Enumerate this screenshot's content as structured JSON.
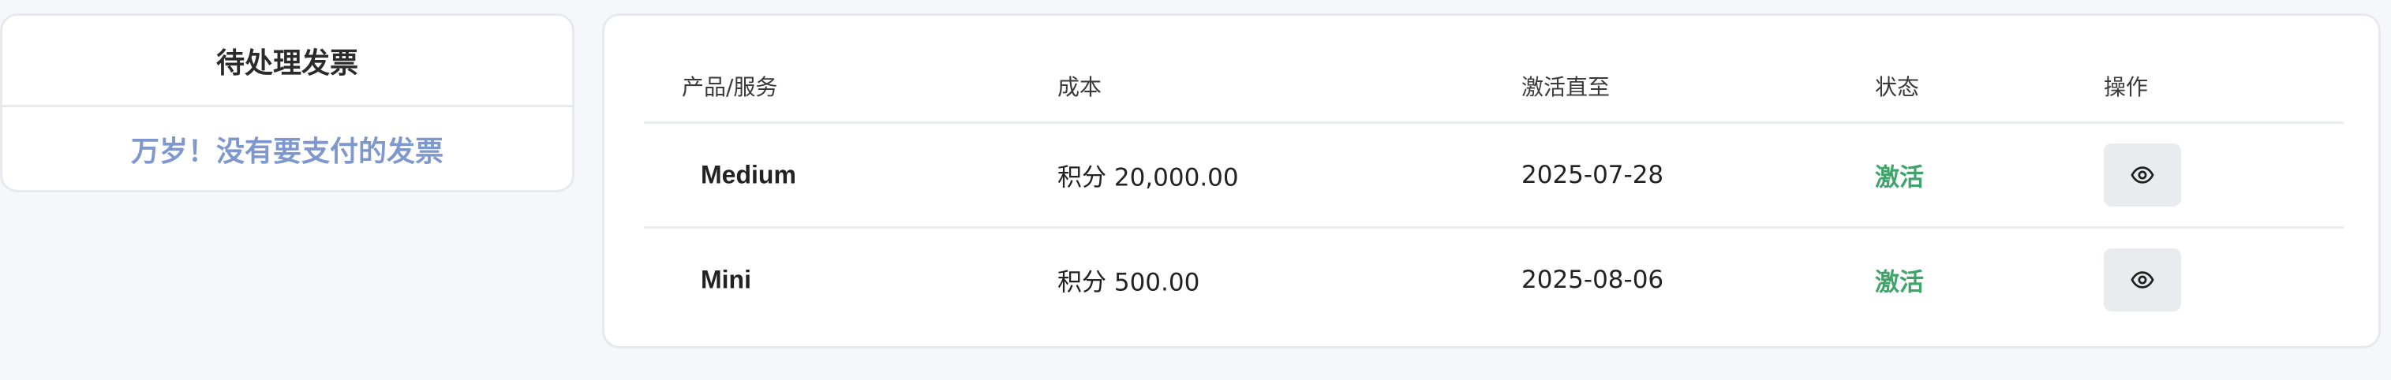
{
  "invoices": {
    "title": "待处理发票",
    "empty_message": "万岁！没有要支付的发票"
  },
  "subscriptions": {
    "columns": [
      "产品/服务",
      "成本",
      "激活直至",
      "状态",
      "操作"
    ],
    "rows": [
      {
        "product": "Medium",
        "cost": "积分 20,000.00",
        "active_until": "2025-07-28",
        "status": "激活",
        "action_icon": "eye-icon"
      },
      {
        "product": "Mini",
        "cost": "积分 500.00",
        "active_until": "2025-08-06",
        "status": "激活",
        "action_icon": "eye-icon"
      }
    ]
  },
  "colors": {
    "background": "#f6f7fb",
    "empty_text": "#7e98cf",
    "status_active": "#3ea46a",
    "button_bg": "#e9ebef"
  }
}
